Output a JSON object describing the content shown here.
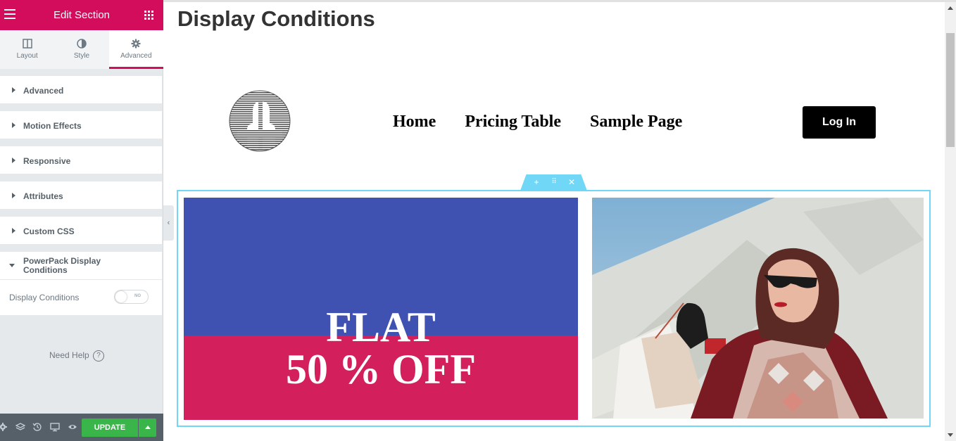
{
  "panel": {
    "title": "Edit Section",
    "tabs": [
      {
        "label": "Layout",
        "icon": "layout-icon"
      },
      {
        "label": "Style",
        "icon": "contrast-icon"
      },
      {
        "label": "Advanced",
        "icon": "gear-icon"
      }
    ],
    "active_tab": "Advanced",
    "sections": [
      {
        "label": "Advanced"
      },
      {
        "label": "Motion Effects"
      },
      {
        "label": "Responsive"
      },
      {
        "label": "Attributes"
      },
      {
        "label": "Custom CSS"
      }
    ],
    "powerpack": {
      "label": "PowerPack Display Conditions",
      "display_conditions_label": "Display Conditions",
      "toggle_state": "NO"
    },
    "need_help": "Need Help",
    "footer": {
      "update_label": "UPDATE",
      "icons": [
        "settings-icon",
        "layers-icon",
        "history-icon",
        "responsive-icon",
        "preview-icon"
      ]
    }
  },
  "preview": {
    "page_title": "Display Conditions",
    "nav": [
      "Home",
      "Pricing Table",
      "Sample Page"
    ],
    "login_label": "Log In",
    "promo": {
      "line1": "FLAT",
      "line2": "50 % OFF"
    }
  },
  "colors": {
    "brand": "#d30c5c",
    "panel_bg": "#e6e9ec",
    "update_green": "#39b54a",
    "promo_blue": "#3f51b1",
    "promo_pink": "#d31f5c",
    "section_outline": "#71d7f7"
  }
}
